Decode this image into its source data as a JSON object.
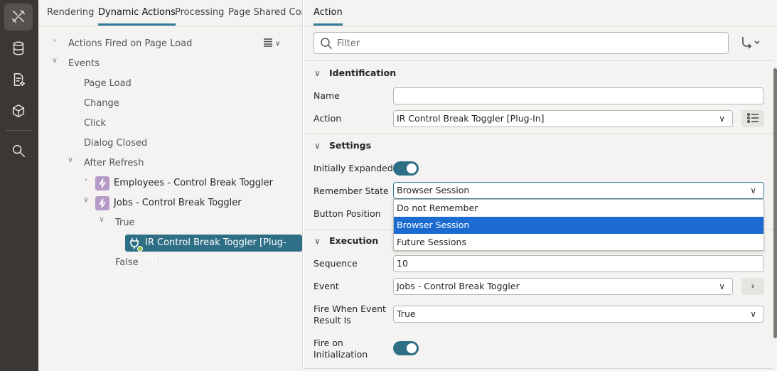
{
  "rail": {
    "items": [
      {
        "icon": "page-designer-icon",
        "active": true
      },
      {
        "icon": "database-icon",
        "active": false
      },
      {
        "icon": "page-sparkle-icon",
        "active": false
      },
      {
        "icon": "cube-icon",
        "active": false
      },
      {
        "icon": "search-icon",
        "active": false
      }
    ]
  },
  "tree": {
    "tabs": [
      "Rendering",
      "Dynamic Actions",
      "Processing",
      "Page Shared Compo"
    ],
    "active_tab": "Dynamic Actions",
    "nodes": {
      "actions_on_load": "Actions Fired on Page Load",
      "events": "Events",
      "page_load": "Page Load",
      "change": "Change",
      "click": "Click",
      "dialog_closed": "Dialog Closed",
      "after_refresh": "After Refresh",
      "employees": "Employees - Control Break Toggler",
      "jobs": "Jobs - Control Break Toggler",
      "true_branch": "True",
      "selected_action": "IR Control Break Toggler [Plug-In]",
      "false_branch": "False"
    }
  },
  "props": {
    "tab": "Action",
    "filter_placeholder": "Filter",
    "sections": {
      "identification": "Identification",
      "settings": "Settings",
      "execution": "Execution"
    },
    "fields": {
      "name_label": "Name",
      "name_value": "",
      "action_label": "Action",
      "action_value": "IR Control Break Toggler [Plug-In]",
      "initially_expanded_label": "Initially Expanded",
      "initially_expanded": true,
      "remember_state_label": "Remember State",
      "remember_state_value": "Browser Session",
      "button_position_label": "Button Position",
      "sequence_label": "Sequence",
      "sequence_value": "10",
      "event_label": "Event",
      "event_value": "Jobs - Control Break Toggler",
      "fire_when_label_1": "Fire When Event",
      "fire_when_label_2": "Result Is",
      "fire_when_value": "True",
      "fire_init_label_1": "Fire on",
      "fire_init_label_2": "Initialization",
      "fire_init": true
    },
    "dropdown_options": [
      "Do not Remember",
      "Browser Session",
      "Future Sessions"
    ],
    "dropdown_selected": "Browser Session"
  },
  "colors": {
    "accent": "#2f6f86",
    "dropdown_highlight": "#1c6bd1",
    "rail_bg": "#3b3834",
    "node_icon_bg": "#b59ac7"
  }
}
